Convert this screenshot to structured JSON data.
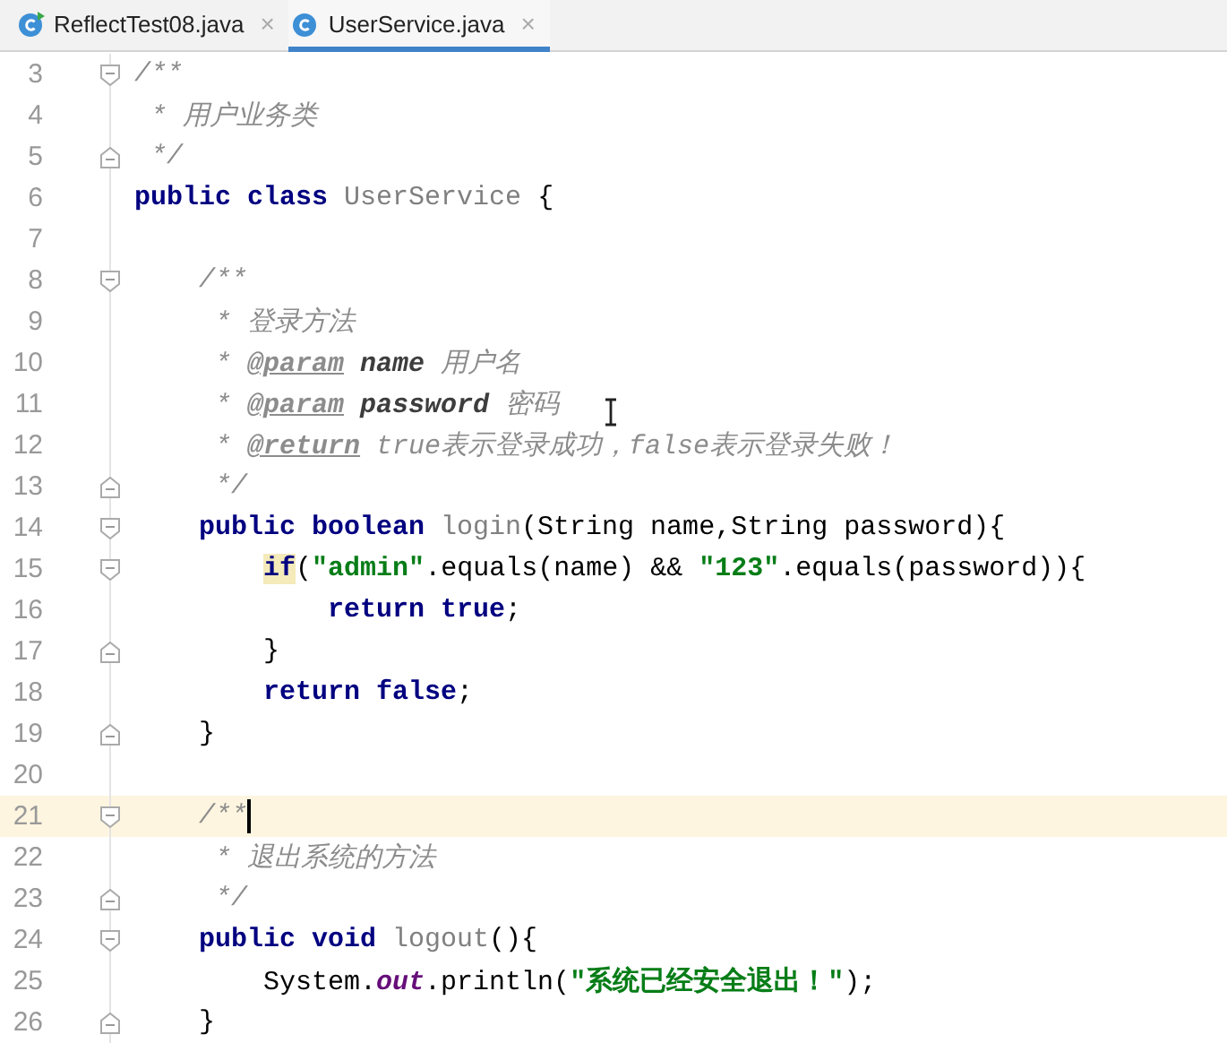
{
  "tabs": [
    {
      "label": "ReflectTest08.java",
      "close": "×",
      "runnable": true,
      "selected": false
    },
    {
      "label": "UserService.java",
      "close": "×",
      "runnable": false,
      "selected": true
    }
  ],
  "editor": {
    "lines": [
      {
        "number": "3",
        "fold_start": true,
        "tokens": [
          {
            "kind": "comment",
            "text": "/**"
          }
        ]
      },
      {
        "number": "4",
        "tokens": [
          {
            "kind": "comment",
            "text": " * 用户业务类"
          }
        ]
      },
      {
        "number": "5",
        "fold_end": true,
        "tokens": [
          {
            "kind": "comment",
            "text": " */"
          }
        ]
      },
      {
        "number": "6",
        "tokens": [
          {
            "kind": "keyword",
            "text": "public class "
          },
          {
            "kind": "unused",
            "text": "UserService"
          },
          {
            "kind": "plain",
            "text": " {"
          }
        ]
      },
      {
        "number": "7"
      },
      {
        "number": "8",
        "fold_start": true,
        "tokens": [
          {
            "kind": "comment",
            "text": "    /**"
          }
        ]
      },
      {
        "number": "9",
        "tokens": [
          {
            "kind": "comment",
            "text": "     * 登录方法"
          }
        ]
      },
      {
        "number": "10",
        "tokens": [
          {
            "kind": "comment",
            "text": "     * "
          },
          {
            "kind": "doc_tag",
            "text": "@param"
          },
          {
            "kind": "doc_param",
            "text": " name"
          },
          {
            "kind": "comment",
            "text": " 用户名"
          }
        ]
      },
      {
        "number": "11",
        "tokens": [
          {
            "kind": "comment",
            "text": "     * "
          },
          {
            "kind": "doc_tag",
            "text": "@param"
          },
          {
            "kind": "doc_param",
            "text": " password"
          },
          {
            "kind": "comment",
            "text": " 密码"
          }
        ]
      },
      {
        "number": "12",
        "tokens": [
          {
            "kind": "comment",
            "text": "     * "
          },
          {
            "kind": "doc_tag",
            "text": "@return"
          },
          {
            "kind": "comment",
            "text": " true表示登录成功，false表示登录失败！"
          }
        ]
      },
      {
        "number": "13",
        "fold_end": true,
        "tokens": [
          {
            "kind": "comment",
            "text": "     */"
          }
        ]
      },
      {
        "number": "14",
        "fold_start": true,
        "tokens": [
          {
            "kind": "keyword",
            "text": "    public boolean "
          },
          {
            "kind": "unused",
            "text": "login"
          },
          {
            "kind": "plain",
            "text": "(String name,String password){"
          }
        ]
      },
      {
        "number": "15",
        "fold_start": true,
        "tokens": [
          {
            "kind": "keyword_match",
            "text": "        if"
          },
          {
            "kind": "plain",
            "text": "("
          },
          {
            "kind": "string",
            "text": "\"admin\""
          },
          {
            "kind": "plain",
            "text": ".equals(name) && "
          },
          {
            "kind": "string",
            "text": "\"123\""
          },
          {
            "kind": "plain",
            "text": ".equals(password)){"
          }
        ]
      },
      {
        "number": "16",
        "tokens": [
          {
            "kind": "keyword",
            "text": "            return true"
          },
          {
            "kind": "plain",
            "text": ";"
          }
        ]
      },
      {
        "number": "17",
        "fold_end": true,
        "tokens": [
          {
            "kind": "plain",
            "text": "        }"
          }
        ]
      },
      {
        "number": "18",
        "tokens": [
          {
            "kind": "keyword",
            "text": "        return false"
          },
          {
            "kind": "plain",
            "text": ";"
          }
        ]
      },
      {
        "number": "19",
        "fold_end": true,
        "tokens": [
          {
            "kind": "plain",
            "text": "    }"
          }
        ]
      },
      {
        "number": "20"
      },
      {
        "number": "21",
        "fold_start": true,
        "current": true,
        "caret": true,
        "tokens": [
          {
            "kind": "comment",
            "text": "    /**"
          }
        ]
      },
      {
        "number": "22",
        "tokens": [
          {
            "kind": "comment",
            "text": "     * 退出系统的方法"
          }
        ]
      },
      {
        "number": "23",
        "fold_end": true,
        "tokens": [
          {
            "kind": "comment",
            "text": "     */"
          }
        ]
      },
      {
        "number": "24",
        "fold_start": true,
        "tokens": [
          {
            "kind": "keyword",
            "text": "    public void "
          },
          {
            "kind": "unused",
            "text": "logout"
          },
          {
            "kind": "plain",
            "text": "(){"
          }
        ]
      },
      {
        "number": "25",
        "tokens": [
          {
            "kind": "plain",
            "text": "        System."
          },
          {
            "kind": "static_field",
            "text": "out"
          },
          {
            "kind": "plain",
            "text": ".println("
          },
          {
            "kind": "string",
            "text": "\"系统已经安全退出！\""
          },
          {
            "kind": "plain",
            "text": ");"
          }
        ]
      },
      {
        "number": "26",
        "fold_end": true,
        "tokens": [
          {
            "kind": "plain",
            "text": "    }"
          }
        ]
      }
    ]
  }
}
